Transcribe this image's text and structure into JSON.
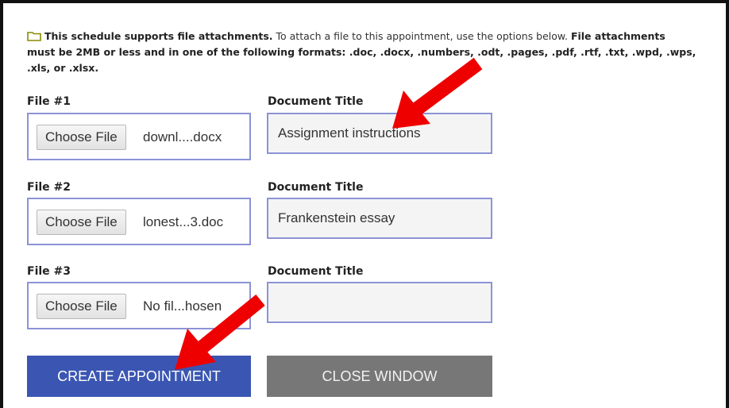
{
  "notice": {
    "bold_intro": "This schedule supports file attachments.",
    "normal_text": " To attach a file to this appointment, use the options below. ",
    "bold_rest_line1": "File attachments",
    "bold_rest_line2": "must be 2MB or less and in one of the following formats: .doc, .docx, .numbers, .odt, .pages, .pdf, .rtf, .txt, .wpd, .wps,",
    "bold_rest_line3": ".xls, or .xlsx."
  },
  "attachments": [
    {
      "file_label": "File #1",
      "choose_label": "Choose File",
      "file_name": "downl....docx",
      "title_label": "Document Title",
      "title_value": "Assignment instructions"
    },
    {
      "file_label": "File #2",
      "choose_label": "Choose File",
      "file_name": "lonest...3.doc",
      "title_label": "Document Title",
      "title_value": "Frankenstein essay"
    },
    {
      "file_label": "File #3",
      "choose_label": "Choose File",
      "file_name": "No fil...hosen",
      "title_label": "Document Title",
      "title_value": ""
    }
  ],
  "buttons": {
    "create": "CREATE APPOINTMENT",
    "close": "CLOSE WINDOW"
  },
  "colors": {
    "create_button": "#3b56b2",
    "close_button": "#777777",
    "input_border": "#8c93d6",
    "annotation_arrow": "#ee0000"
  }
}
